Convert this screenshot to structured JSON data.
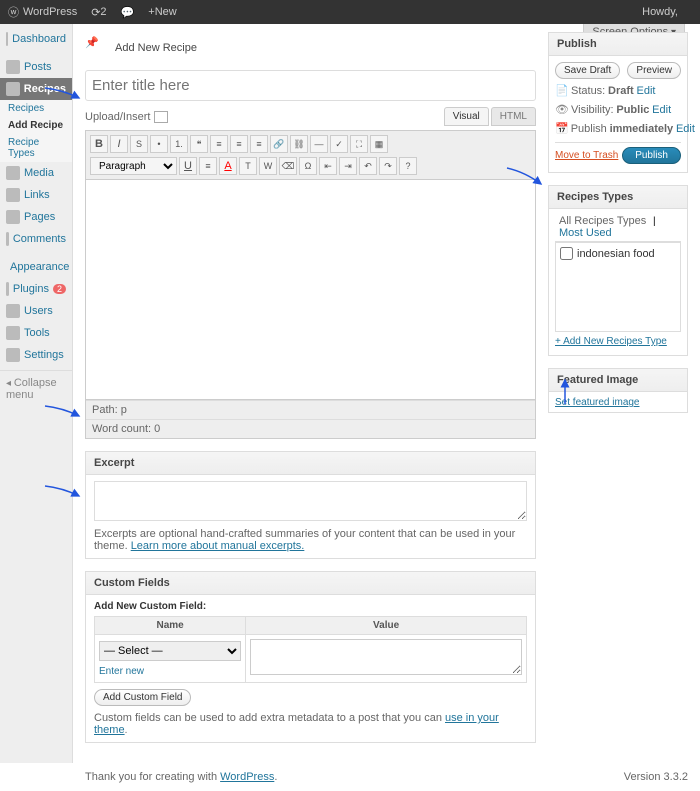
{
  "topbar": {
    "site": "WordPress",
    "comments": "2",
    "new": "New",
    "howdy": "Howdy,",
    "screen_options": "Screen Options"
  },
  "sidebar": {
    "dashboard": "Dashboard",
    "posts": "Posts",
    "recipes": "Recipes",
    "sub_recipes": "Recipes",
    "sub_add": "Add Recipe",
    "sub_types": "Recipe Types",
    "media": "Media",
    "links": "Links",
    "pages": "Pages",
    "comments": "Comments",
    "appearance": "Appearance",
    "plugins": "Plugins",
    "plugins_count": "2",
    "users": "Users",
    "tools": "Tools",
    "settings": "Settings",
    "collapse": "Collapse menu"
  },
  "page": {
    "title": "Add New Recipe",
    "title_placeholder": "Enter title here",
    "upload": "Upload/Insert"
  },
  "editor": {
    "visual": "Visual",
    "html": "HTML",
    "paragraph": "Paragraph",
    "path": "Path: p",
    "wordcount": "Word count: 0"
  },
  "publish": {
    "heading": "Publish",
    "save_draft": "Save Draft",
    "preview": "Preview",
    "status_label": "Status:",
    "status_val": "Draft",
    "vis_label": "Visibility:",
    "vis_val": "Public",
    "sched_label": "Publish",
    "sched_val": "immediately",
    "edit": "Edit",
    "trash": "Move to Trash",
    "publish_btn": "Publish"
  },
  "tax": {
    "heading": "Recipes Types",
    "all": "All Recipes Types",
    "most": "Most Used",
    "item": "indonesian food",
    "add": "+ Add New Recipes Type"
  },
  "feat": {
    "heading": "Featured Image",
    "set": "Set featured image"
  },
  "excerpt": {
    "heading": "Excerpt",
    "hint": "Excerpts are optional hand-crafted summaries of your content that can be used in your theme. ",
    "hint_link": "Learn more about manual excerpts."
  },
  "cf": {
    "heading": "Custom Fields",
    "addnew": "Add New Custom Field:",
    "name": "Name",
    "value": "Value",
    "select": "— Select —",
    "enter": "Enter new",
    "addbtn": "Add Custom Field",
    "hint": "Custom fields can be used to add extra metadata to a post that you can ",
    "hint_link": "use in your theme"
  },
  "footer": {
    "thank": "Thank you for creating with ",
    "wp": "WordPress",
    "version": "Version 3.3.2"
  }
}
